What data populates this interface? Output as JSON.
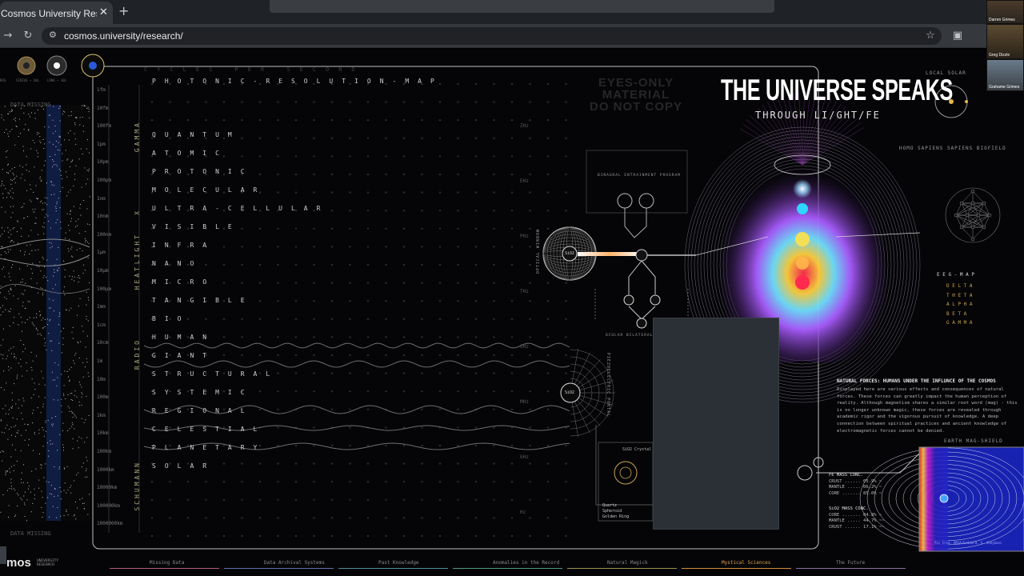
{
  "browser": {
    "tab_title": "Cosmos University Research - T",
    "tab_close": "✕",
    "new_tab": "+",
    "url": "cosmos.university/research/",
    "icons": [
      "back-arrow-icon",
      "reload-icon",
      "site-settings-icon",
      "bookmark-star-icon",
      "split-view-icon"
    ]
  },
  "page": {
    "top_labels": [
      "CYCLES  PER  SECOND"
    ],
    "left_panel": {
      "data_missing_top": "DATA MISSING",
      "data_missing_bottom": "DATA MISSING",
      "planet_labels": [
        "RUS",
        "SIRIUS ~ 10L",
        "LUNA ~ 10L"
      ]
    },
    "map_title": "PHOTONIC-RESOLUTION-MAP",
    "rows": [
      "QUANTUM",
      "ATOMIC",
      "PROTONIC",
      "MOLECULAR",
      "ULTRA-CELLULAR",
      "VISIBLE",
      "INFRA",
      "NANO",
      "MICRO",
      "TANGIBLE",
      "BIO",
      "HUMAN",
      "GIANT",
      "STRUCTURAL",
      "SYSTEMIC",
      "REGIONAL",
      "CELESTIAL",
      "PLANETARY",
      "SOLAR"
    ],
    "scale_labels": [
      "1fm",
      "10fm",
      "100fm",
      "1pm",
      "10pm",
      "100pm",
      "1nm",
      "10nm",
      "100nm",
      "1μm",
      "10μm",
      "100μm",
      "1mm",
      "1cm",
      "10cm",
      "1m",
      "10m",
      "100m",
      "1km",
      "10km",
      "100km",
      "1000km",
      "10000km",
      "100000km",
      "1000000km"
    ],
    "bands": [
      "GAMMA",
      "X",
      "LIGHT",
      "HEAT",
      "RADIO",
      "SCHUMANN"
    ],
    "hz_labels": [
      "ZHz",
      "EHz",
      "PHz",
      "THz",
      "GHz",
      "MHz",
      "kHz",
      "Hz"
    ],
    "eyes_only": [
      "EYES-ONLY",
      "MATERIAL",
      "DO NOT COPY"
    ],
    "headline": "THE UNIVERSE SPEAKS",
    "subheadline": "THROUGH LI/GHT/FE",
    "local_solar": "LOCAL SOLAR",
    "biofield": "HOMO SAPIENS SAPIENS BIOFIELD",
    "eeg_map": "E E G - M A P",
    "eeg_rows": [
      "D E L T A",
      "T H E T A",
      "A L P H A",
      "B E T A",
      "G A M M A"
    ],
    "binaural": "BINAURAL ENTRAINMENT PROGRAM",
    "ocular": "OCULAR BILATERAL",
    "piezo": "PIEZOELECTRIC PORTAL",
    "optical": "OPTICAL WINDOW",
    "sio2_node_1": "SiO2",
    "sio2_node_2": "SiO2",
    "crystal_label": "SiO2 Crystal",
    "crystal_items": [
      "Quartz",
      "Spheroid",
      "Golden Ring"
    ],
    "natural_heading": "NATURAL FORCES: HUMANS UNDER THE INFLUNCE OF THE COSMOS",
    "natural_body": "Displayed here are various effects and consequences of natural forces. These forces can greatly impact the human perception of reality. Although magnetism shares a similar root word (mag) - this is no longer unknown magic, these forces are revealed through academic rigor and the vigorous pursuit of knowledge. A deep connection between spiritual practices and ancient knowledge of electromagnetic forces cannot be denied.",
    "fe_mass": {
      "title": "FE MASS CONC.",
      "rows": [
        "CRUST ...... 05.9% ~",
        "MANTLE ..... 06.2% ~",
        "CORE ....... 85.0% ~"
      ]
    },
    "sio2_mass": {
      "title": "SiO2 MASS CONC.",
      "rows": [
        "CORE ....... 04.8% ~",
        "MANTLE ..... 44.7% ~~",
        "CRUST ...... 17.1% ~~"
      ]
    },
    "earth_shield": "EARTH MAG-SHIELD",
    "earth_credit": "Pic Cred: NASA/Goddard, S. Sheybani",
    "footer_logo": "mos",
    "footer_logo_sub": [
      "UNIVERSITY",
      "RESEARCH"
    ],
    "footer_nav": [
      "Missing Data",
      "Data Archival Systems",
      "Past Knowledge",
      "Anomalies in the Record",
      "Natural Magick",
      "Mystical Sciences",
      "The Future"
    ],
    "footer_colors": [
      "#b35a7a",
      "#5d6fae",
      "#4f8a9c",
      "#4d9a7a",
      "#9a8f4e",
      "#d48a3a",
      "#8a6aa5"
    ],
    "active_nav": "Mystical Sciences"
  },
  "meeting": {
    "participants": [
      "Darren Grimes",
      "Greg Dizzle",
      "Grahame Grimes"
    ]
  },
  "colors": {
    "accent_gold": "#c9a24a",
    "nav_active": "#e3a24d",
    "band_label": "#a9a57e"
  }
}
